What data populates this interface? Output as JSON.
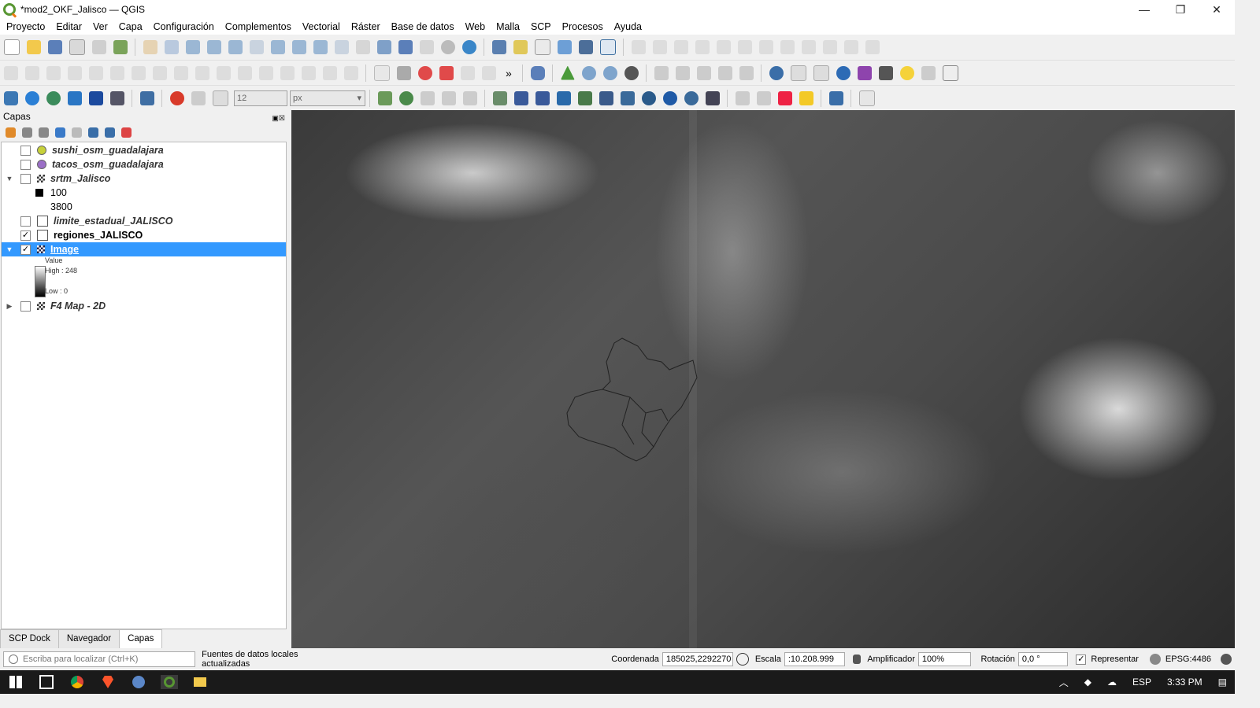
{
  "window": {
    "title": "*mod2_OKF_Jalisco — QGIS",
    "controls": [
      "—",
      "❐",
      "✕"
    ]
  },
  "menu": [
    "Proyecto",
    "Editar",
    "Ver",
    "Capa",
    "Configuración",
    "Complementos",
    "Vectorial",
    "Ráster",
    "Base de datos",
    "Web",
    "Malla",
    "SCP",
    "Procesos",
    "Ayuda"
  ],
  "toolbar": {
    "size_value": "12",
    "unit_value": "px",
    "overflow": "»"
  },
  "layers_panel": {
    "title": "Capas",
    "layers": [
      {
        "name": "sushi_osm_guadalajara",
        "checked": false,
        "icon": "point-layer-icon",
        "color": "#c7d13a"
      },
      {
        "name": "tacos_osm_guadalajara",
        "checked": false,
        "icon": "point-layer-icon",
        "color": "#9b6fc7"
      },
      {
        "name": "srtm_Jalisco",
        "checked": false,
        "icon": "raster-layer-icon",
        "expanded": true,
        "legend": [
          "100",
          "3800"
        ]
      },
      {
        "name": "limite_estadual_JALISCO",
        "checked": false,
        "icon": "polygon-layer-icon"
      },
      {
        "name": "regiones_JALISCO",
        "checked": true,
        "icon": "polygon-layer-icon"
      },
      {
        "name": "Image",
        "checked": true,
        "selected": true,
        "icon": "raster-layer-icon",
        "expanded": true,
        "legend_title": "Value",
        "high": "High : 248",
        "low": "Low : 0"
      },
      {
        "name": "F4 Map - 2D",
        "checked": false,
        "icon": "raster-layer-icon"
      }
    ],
    "tabs": [
      "SCP Dock",
      "Navegador",
      "Capas"
    ],
    "active_tab": "Capas"
  },
  "status": {
    "locator_placeholder": "Escriba para localizar (Ctrl+K)",
    "message": "Fuentes de datos locales actualizadas",
    "coord_label": "Coordenada",
    "coord_value": "185025,2292270",
    "scale_label": "Escala",
    "scale_value": ":10.208.999",
    "magnifier_label": "Amplificador",
    "magnifier_value": "100%",
    "rotation_label": "Rotación",
    "rotation_value": "0,0 °",
    "render_label": "Representar",
    "render_checked": true,
    "crs": "EPSG:4486"
  },
  "taskbar": {
    "lang": "ESP",
    "time": "3:33 PM"
  }
}
